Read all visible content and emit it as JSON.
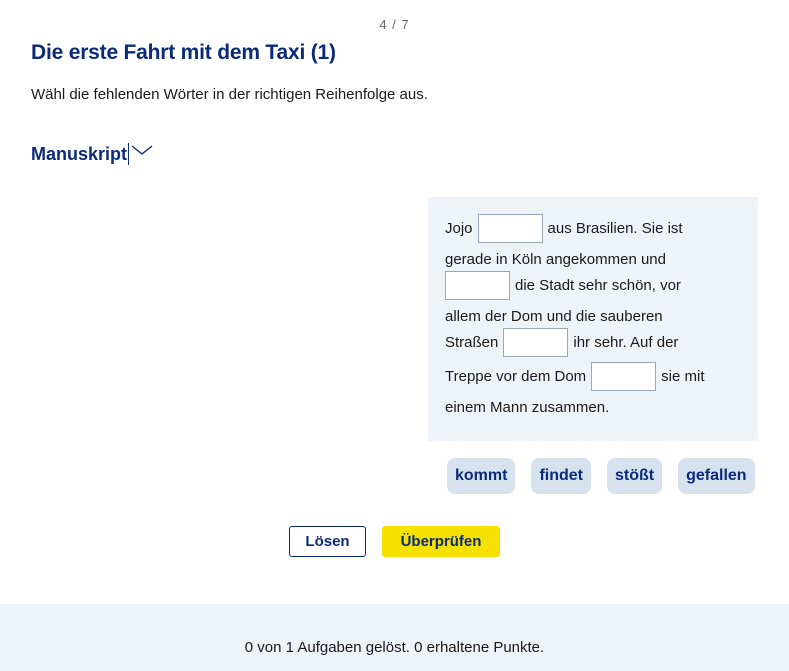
{
  "progress": "4 / 7",
  "title": "Die erste Fahrt mit dem Taxi (1)",
  "instruction": "Wähl die fehlenden Wörter in der richtigen Reihenfolge aus.",
  "manuskript": {
    "label": "Manuskript",
    "icon": "chevron-down-icon",
    "expanded": false
  },
  "task": {
    "segments": {
      "s1": "Jojo",
      "s2": "aus Brasilien. Sie ist",
      "s3": "gerade in Köln angekommen und",
      "s4": "die Stadt sehr schön, vor",
      "s5": "allem der Dom und die sauberen",
      "s6": "Straßen",
      "s7": "ihr sehr. Auf der",
      "s8": "Treppe vor dem Dom",
      "s9": "sie mit",
      "s10": "einem Mann zusammen."
    },
    "gaps": [
      "",
      "",
      "",
      ""
    ]
  },
  "word_options": [
    "kommt",
    "findet",
    "stößt",
    "gefallen"
  ],
  "buttons": {
    "solve": "Lösen",
    "check": "Überprüfen"
  },
  "footer": {
    "status": "0 von 1 Aufgaben gelöst. 0 erhaltene Punkte."
  },
  "colors": {
    "primary": "#0b2a7a",
    "accent_yellow": "#f5e100",
    "panel_bg": "#eef3f8",
    "chip_bg": "#d6e3ef"
  }
}
